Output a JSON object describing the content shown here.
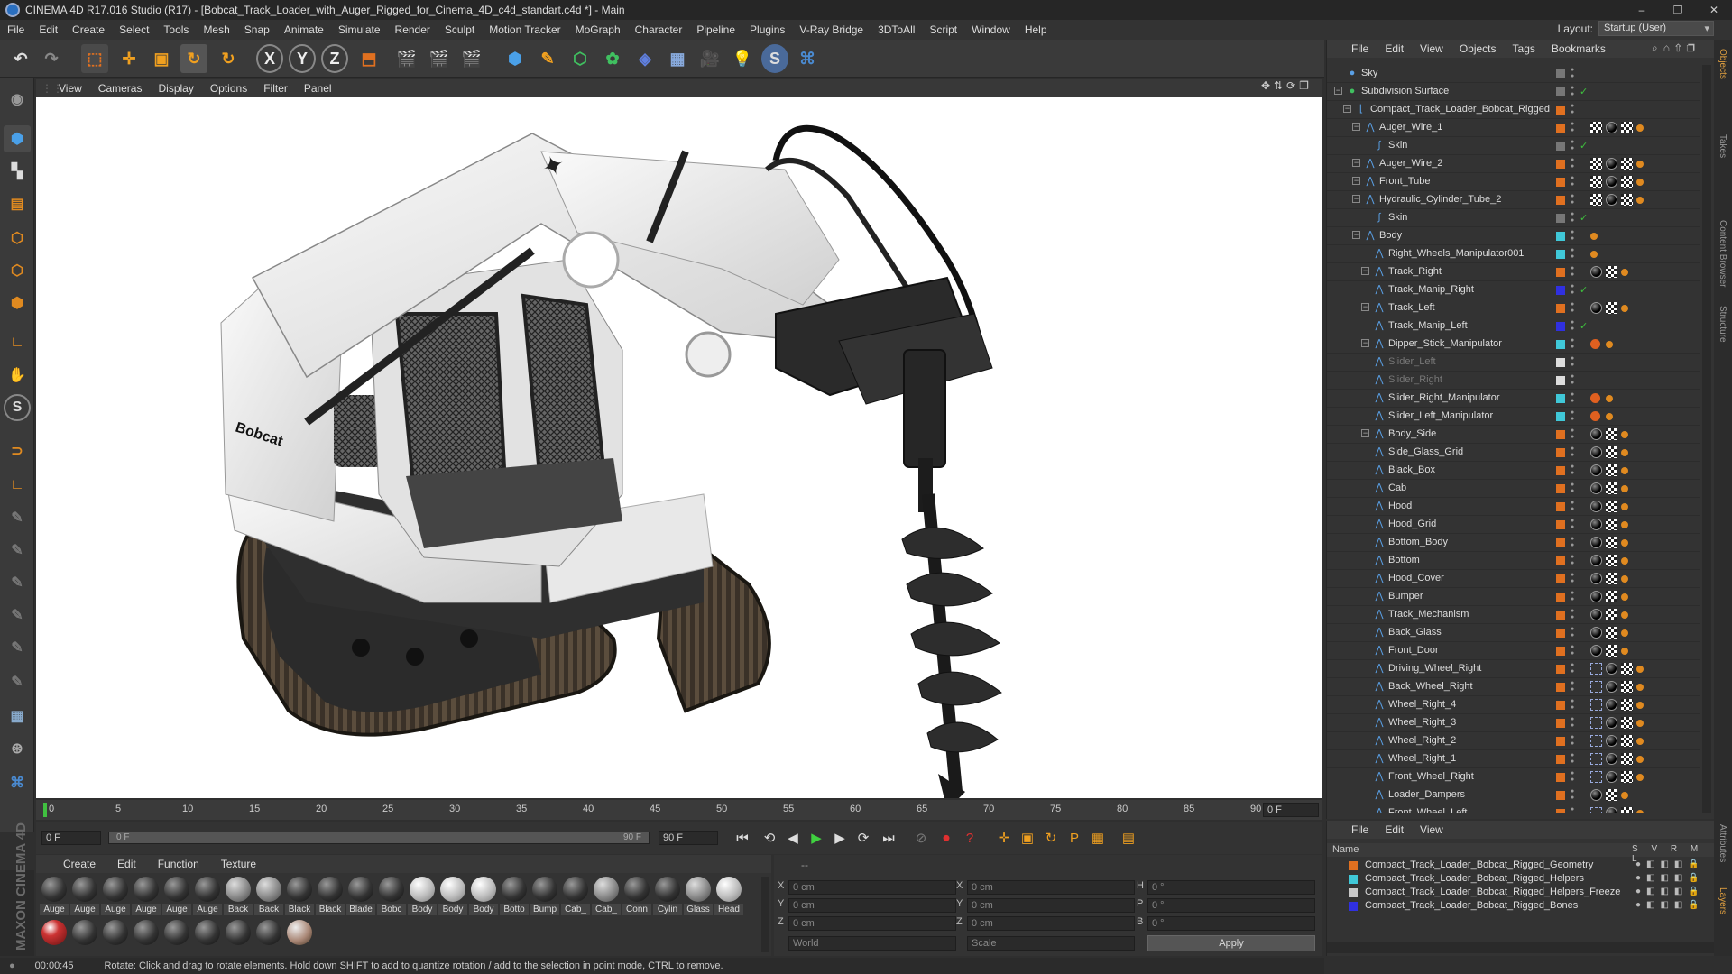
{
  "titlebar": {
    "title": "CINEMA 4D R17.016 Studio (R17) - [Bobcat_Track_Loader_with_Auger_Rigged_for_Cinema_4D_c4d_standart.c4d *] - Main"
  },
  "menubar": {
    "items": [
      "File",
      "Edit",
      "Create",
      "Select",
      "Tools",
      "Mesh",
      "Snap",
      "Animate",
      "Simulate",
      "Render",
      "Sculpt",
      "Motion Tracker",
      "MoGraph",
      "Character",
      "Pipeline",
      "Plugins",
      "V-Ray Bridge",
      "3DToAll",
      "Script",
      "Window",
      "Help"
    ]
  },
  "layout": {
    "label": "Layout:",
    "value": "Startup (User)"
  },
  "viewport_menu": {
    "items": [
      "View",
      "Cameras",
      "Display",
      "Options",
      "Filter",
      "Panel"
    ]
  },
  "timeline": {
    "ticks": [
      "0",
      "5",
      "10",
      "15",
      "20",
      "25",
      "30",
      "35",
      "40",
      "45",
      "50",
      "55",
      "60",
      "65",
      "70",
      "75",
      "80",
      "85",
      "90"
    ],
    "end_field": "0 F"
  },
  "range": {
    "start": "0 F",
    "inner_start": "0 F",
    "inner_end": "90 F",
    "end": "90 F"
  },
  "materials": {
    "menu": [
      "Create",
      "Edit",
      "Function",
      "Texture"
    ],
    "row1": [
      {
        "label": "Auge",
        "style": "dark"
      },
      {
        "label": "Auge",
        "style": "dark"
      },
      {
        "label": "Auge",
        "style": "dark"
      },
      {
        "label": "Auge",
        "style": "dark"
      },
      {
        "label": "Auge",
        "style": "dark"
      },
      {
        "label": "Auge",
        "style": "dark"
      },
      {
        "label": "Back",
        "style": "grey"
      },
      {
        "label": "Back",
        "style": "grey"
      },
      {
        "label": "Black",
        "style": "dark"
      },
      {
        "label": "Black",
        "style": "dark"
      },
      {
        "label": "Blade",
        "style": "dark"
      },
      {
        "label": "Bobc",
        "style": "dark"
      },
      {
        "label": "Body",
        "style": "white"
      },
      {
        "label": "Body",
        "style": "white"
      },
      {
        "label": "Body",
        "style": "white"
      },
      {
        "label": "Botto",
        "style": "dark"
      },
      {
        "label": "Bump",
        "style": "dark"
      },
      {
        "label": "Cab_",
        "style": "dark"
      },
      {
        "label": "Cab_",
        "style": "grey"
      },
      {
        "label": "Conn",
        "style": "dark"
      },
      {
        "label": "Cylin",
        "style": "dark"
      },
      {
        "label": "Glass",
        "style": "grey"
      },
      {
        "label": "Head",
        "style": "white"
      }
    ],
    "row2": [
      {
        "style": "red"
      },
      {
        "style": "dark"
      },
      {
        "style": "dark"
      },
      {
        "style": "dark"
      },
      {
        "style": "dark"
      },
      {
        "style": "dark"
      },
      {
        "style": "dark"
      },
      {
        "style": "dark"
      },
      {
        "style": "tan"
      }
    ]
  },
  "coords": {
    "header": "--",
    "pos": [
      {
        "axis": "X",
        "value": "0 cm"
      },
      {
        "axis": "Y",
        "value": "0 cm"
      },
      {
        "axis": "Z",
        "value": "0 cm"
      }
    ],
    "size": [
      {
        "axis": "X",
        "value": "0 cm"
      },
      {
        "axis": "Y",
        "value": "0 cm"
      },
      {
        "axis": "Z",
        "value": "0 cm"
      }
    ],
    "rot": [
      {
        "axis": "H",
        "value": "0 °"
      },
      {
        "axis": "P",
        "value": "0 °"
      },
      {
        "axis": "B",
        "value": "0 °"
      }
    ],
    "mode1": "World",
    "mode2": "Scale",
    "apply": "Apply"
  },
  "status": {
    "time": "00:00:45",
    "message": "Rotate: Click and drag to rotate elements. Hold down SHIFT to add to quantize rotation / add to the selection in point mode, CTRL to remove."
  },
  "objects": {
    "menu": [
      "File",
      "Edit",
      "View",
      "Objects",
      "Tags",
      "Bookmarks"
    ],
    "rows": [
      {
        "name": "Sky",
        "indent": 0,
        "color": "#777",
        "tags": "",
        "expand": false,
        "dim": false
      },
      {
        "name": "Subdivision Surface",
        "indent": 0,
        "color": "#777",
        "tags": "",
        "expand": true,
        "dim": false,
        "check": true
      },
      {
        "name": "Compact_Track_Loader_Bobcat_Rigged",
        "indent": 1,
        "color": "#e07020",
        "tags": "",
        "expand": true,
        "dim": false
      },
      {
        "name": "Auger_Wire_1",
        "indent": 2,
        "color": "#e07020",
        "tags": "cbcd",
        "expand": true,
        "dim": false
      },
      {
        "name": "Skin",
        "indent": 3,
        "color": "#777",
        "tags": "",
        "expand": false,
        "dim": false,
        "check": true
      },
      {
        "name": "Auger_Wire_2",
        "indent": 2,
        "color": "#e07020",
        "tags": "cbcd",
        "expand": true,
        "dim": false
      },
      {
        "name": "Front_Tube",
        "indent": 2,
        "color": "#e07020",
        "tags": "cbcd",
        "expand": true,
        "dim": false
      },
      {
        "name": "Hydraulic_Cylinder_Tube_2",
        "indent": 2,
        "color": "#e07020",
        "tags": "cbcd",
        "expand": true,
        "dim": false
      },
      {
        "name": "Skin",
        "indent": 3,
        "color": "#777",
        "tags": "",
        "expand": false,
        "dim": false,
        "check": true
      },
      {
        "name": "Body",
        "indent": 2,
        "color": "#40c8d8",
        "tags": "d",
        "expand": true,
        "dim": false
      },
      {
        "name": "Right_Wheels_Manipulator001",
        "indent": 3,
        "color": "#40c8d8",
        "tags": "d",
        "expand": false,
        "dim": false
      },
      {
        "name": "Track_Right",
        "indent": 3,
        "color": "#e07020",
        "tags": "bcd",
        "expand": true,
        "dim": false
      },
      {
        "name": "Track_Manip_Right",
        "indent": 3,
        "color": "#3030e0",
        "tags": "",
        "expand": false,
        "dim": false,
        "check": true
      },
      {
        "name": "Track_Left",
        "indent": 3,
        "color": "#e07020",
        "tags": "bcd",
        "expand": true,
        "dim": false
      },
      {
        "name": "Track_Manip_Left",
        "indent": 3,
        "color": "#3030e0",
        "tags": "",
        "expand": false,
        "dim": false,
        "check": true
      },
      {
        "name": "Dipper_Stick_Manipulator",
        "indent": 3,
        "color": "#40c8d8",
        "tags": "xd",
        "expand": true,
        "dim": false
      },
      {
        "name": "Slider_Left",
        "indent": 3,
        "color": "#ddd",
        "tags": "",
        "expand": false,
        "dim": true
      },
      {
        "name": "Slider_Right",
        "indent": 3,
        "color": "#ddd",
        "tags": "",
        "expand": false,
        "dim": true
      },
      {
        "name": "Slider_Right_Manipulator",
        "indent": 3,
        "color": "#40c8d8",
        "tags": "xd",
        "expand": false,
        "dim": false
      },
      {
        "name": "Slider_Left_Manipulator",
        "indent": 3,
        "color": "#40c8d8",
        "tags": "xd",
        "expand": false,
        "dim": false
      },
      {
        "name": "Body_Side",
        "indent": 3,
        "color": "#e07020",
        "tags": "bcd",
        "expand": true,
        "dim": false
      },
      {
        "name": "Side_Glass_Grid",
        "indent": 3,
        "color": "#e07020",
        "tags": "bcd",
        "expand": false,
        "dim": false
      },
      {
        "name": "Black_Box",
        "indent": 3,
        "color": "#e07020",
        "tags": "bcd",
        "expand": false,
        "dim": false
      },
      {
        "name": "Cab",
        "indent": 3,
        "color": "#e07020",
        "tags": "bcd",
        "expand": false,
        "dim": false
      },
      {
        "name": "Hood",
        "indent": 3,
        "color": "#e07020",
        "tags": "bcd",
        "expand": false,
        "dim": false
      },
      {
        "name": "Hood_Grid",
        "indent": 3,
        "color": "#e07020",
        "tags": "bcd",
        "expand": false,
        "dim": false
      },
      {
        "name": "Bottom_Body",
        "indent": 3,
        "color": "#e07020",
        "tags": "bcd",
        "expand": false,
        "dim": false
      },
      {
        "name": "Bottom",
        "indent": 3,
        "color": "#e07020",
        "tags": "bcd",
        "expand": false,
        "dim": false
      },
      {
        "name": "Hood_Cover",
        "indent": 3,
        "color": "#e07020",
        "tags": "bcd",
        "expand": false,
        "dim": false
      },
      {
        "name": "Bumper",
        "indent": 3,
        "color": "#e07020",
        "tags": "bcd",
        "expand": false,
        "dim": false
      },
      {
        "name": "Track_Mechanism",
        "indent": 3,
        "color": "#e07020",
        "tags": "bcd",
        "expand": false,
        "dim": false
      },
      {
        "name": "Back_Glass",
        "indent": 3,
        "color": "#e07020",
        "tags": "bcd",
        "expand": false,
        "dim": false
      },
      {
        "name": "Front_Door",
        "indent": 3,
        "color": "#e07020",
        "tags": "bcd",
        "expand": false,
        "dim": false
      },
      {
        "name": "Driving_Wheel_Right",
        "indent": 3,
        "color": "#e07020",
        "tags": "wbcd",
        "expand": false,
        "dim": false
      },
      {
        "name": "Back_Wheel_Right",
        "indent": 3,
        "color": "#e07020",
        "tags": "wbcd",
        "expand": false,
        "dim": false
      },
      {
        "name": "Wheel_Right_4",
        "indent": 3,
        "color": "#e07020",
        "tags": "wbcd",
        "expand": false,
        "dim": false
      },
      {
        "name": "Wheel_Right_3",
        "indent": 3,
        "color": "#e07020",
        "tags": "wbcd",
        "expand": false,
        "dim": false
      },
      {
        "name": "Wheel_Right_2",
        "indent": 3,
        "color": "#e07020",
        "tags": "wbcd",
        "expand": false,
        "dim": false
      },
      {
        "name": "Wheel_Right_1",
        "indent": 3,
        "color": "#e07020",
        "tags": "wbcd",
        "expand": false,
        "dim": false
      },
      {
        "name": "Front_Wheel_Right",
        "indent": 3,
        "color": "#e07020",
        "tags": "wbcd",
        "expand": false,
        "dim": false
      },
      {
        "name": "Loader_Dampers",
        "indent": 3,
        "color": "#e07020",
        "tags": "bcd",
        "expand": false,
        "dim": false
      },
      {
        "name": "Front_Wheel_Left",
        "indent": 3,
        "color": "#e07020",
        "tags": "wbcd",
        "expand": false,
        "dim": false
      }
    ]
  },
  "layers": {
    "menu": [
      "File",
      "Edit",
      "View"
    ],
    "header": {
      "name": "Name",
      "cols": "S V R M L"
    },
    "rows": [
      {
        "name": "Compact_Track_Loader_Bobcat_Rigged_Geometry",
        "color": "#e07020"
      },
      {
        "name": "Compact_Track_Loader_Bobcat_Rigged_Helpers",
        "color": "#40c8d8"
      },
      {
        "name": "Compact_Track_Loader_Bobcat_Rigged_Helpers_Freeze",
        "color": "#c8c8c8"
      },
      {
        "name": "Compact_Track_Loader_Bobcat_Rigged_Bones",
        "color": "#3030e0"
      }
    ]
  },
  "side_tabs": [
    "Objects",
    "Takes",
    "Content Browser",
    "Structure"
  ],
  "side_tabs_lower": [
    "Attributes",
    "Layers"
  ],
  "viewport_decals": {
    "brand": "Bobcat"
  },
  "maxon": "MAXON CINEMA 4D"
}
